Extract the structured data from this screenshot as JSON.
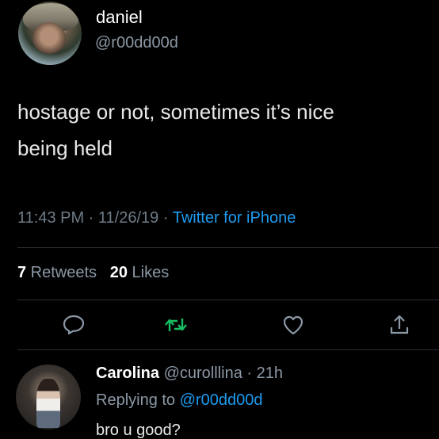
{
  "tweet": {
    "author_name": "daniel",
    "author_handle": "@r00dd00d",
    "line1": "hostage or not, sometimes it’s nice",
    "line2": "being held",
    "time": "11:43 PM",
    "sep1": " · ",
    "date": "11/26/19",
    "sep2": " · ",
    "client": "Twitter for iPhone"
  },
  "stats": {
    "retweets_count": "7",
    "retweets_label": " Retweets",
    "likes_count": "20",
    "likes_label": " Likes"
  },
  "actions": {
    "reply_icon": "reply-icon",
    "retweet_icon": "retweet-icon",
    "like_icon": "heart-icon",
    "share_icon": "share-icon"
  },
  "reply": {
    "name": "Carolina",
    "handle": " @curolllina",
    "time": " · 21h",
    "replying_prefix": "Replying to ",
    "replying_to": "@r00dd00d",
    "text": "bro u good?"
  },
  "colors": {
    "background": "#000000",
    "link": "#1d9bf0",
    "retweet_active": "#17bf63",
    "muted": "#8b98a5"
  }
}
